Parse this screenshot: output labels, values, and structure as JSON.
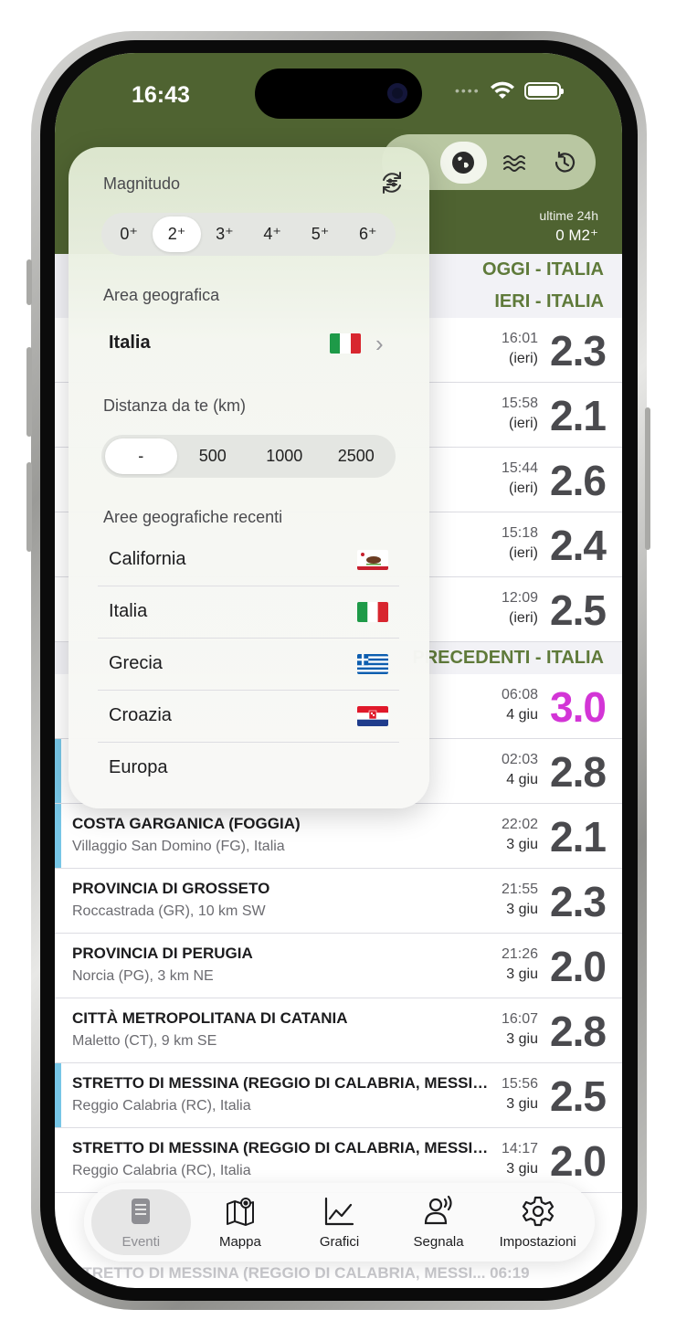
{
  "status": {
    "time": "16:43"
  },
  "header": {
    "segments": [
      {
        "icon": "globe-icon",
        "active": true
      },
      {
        "icon": "waves-icon",
        "active": false
      },
      {
        "icon": "history-icon",
        "active": false
      }
    ],
    "period_label": "ultime 24h",
    "filter_label": "0 M2⁺"
  },
  "sections": [
    {
      "title": "OGGI - ITALIA"
    },
    {
      "title": "IERI - ITALIA"
    },
    {
      "title": "PRECEDENTI - ITALIA"
    }
  ],
  "events_yesterday": [
    {
      "time": "16:01",
      "date": "(ieri)",
      "mag": "2.3",
      "mag_color": "#4a4a4e"
    },
    {
      "time": "15:58",
      "date": "(ieri)",
      "mag": "2.1",
      "mag_color": "#4a4a4e"
    },
    {
      "time": "15:44",
      "date": "(ieri)",
      "mag": "2.6",
      "mag_color": "#4a4a4e"
    },
    {
      "time": "15:18",
      "date": "(ieri)",
      "mag": "2.4",
      "mag_color": "#4a4a4e"
    },
    {
      "time": "12:09",
      "date": "(ieri)",
      "mag": "2.5",
      "mag_color": "#4a4a4e"
    }
  ],
  "events_previous": [
    {
      "title": "",
      "subtitle": "",
      "time": "06:08",
      "date": "4 giu",
      "mag": "3.0",
      "mag_color": "#d335d6",
      "accent": false
    },
    {
      "title": "",
      "subtitle": "",
      "time": "02:03",
      "date": "4 giu",
      "mag": "2.8",
      "mag_color": "#4a4a4e",
      "accent": true
    },
    {
      "title": "COSTA GARGANICA (FOGGIA)",
      "subtitle": "Villaggio San Domino (FG), Italia",
      "time": "22:02",
      "date": "3 giu",
      "mag": "2.1",
      "mag_color": "#4a4a4e",
      "accent": true
    },
    {
      "title": "PROVINCIA DI GROSSETO",
      "subtitle": "Roccastrada (GR), 10 km SW",
      "time": "21:55",
      "date": "3 giu",
      "mag": "2.3",
      "mag_color": "#4a4a4e",
      "accent": false
    },
    {
      "title": "PROVINCIA DI PERUGIA",
      "subtitle": "Norcia (PG), 3 km NE",
      "time": "21:26",
      "date": "3 giu",
      "mag": "2.0",
      "mag_color": "#4a4a4e",
      "accent": false
    },
    {
      "title": "CITTÀ METROPOLITANA DI CATANIA",
      "subtitle": "Maletto (CT), 9 km SE",
      "time": "16:07",
      "date": "3 giu",
      "mag": "2.8",
      "mag_color": "#4a4a4e",
      "accent": false
    },
    {
      "title": "STRETTO DI MESSINA (REGGIO DI CALABRIA, MESSINA)",
      "subtitle": "Reggio Calabria (RC), Italia",
      "time": "15:56",
      "date": "3 giu",
      "mag": "2.5",
      "mag_color": "#4a4a4e",
      "accent": true
    },
    {
      "title": "STRETTO DI MESSINA (REGGIO DI CALABRIA, MESSINA)",
      "subtitle": "Reggio Calabria (RC), Italia",
      "time": "14:17",
      "date": "3 giu",
      "mag": "2.0",
      "mag_color": "#4a4a4e",
      "accent": false
    }
  ],
  "bottom_ghost_text": "STRETTO DI MESSINA (REGGIO DI CALABRIA, MESSI...  06:19",
  "popup": {
    "magnitude_label": "Magnitudo",
    "magnitudes": [
      "0⁺",
      "2⁺",
      "3⁺",
      "4⁺",
      "5⁺",
      "6⁺"
    ],
    "magnitude_selected": 1,
    "area_label": "Area geografica",
    "area_selected": "Italia",
    "distance_label": "Distanza da te (km)",
    "distances": [
      "-",
      "500",
      "1000",
      "2500"
    ],
    "distance_selected": 0,
    "recent_label": "Aree geografiche recenti",
    "recent": [
      {
        "name": "California",
        "flag": "california-flag-icon"
      },
      {
        "name": "Italia",
        "flag": "italy-flag-icon"
      },
      {
        "name": "Grecia",
        "flag": "greece-flag-icon"
      },
      {
        "name": "Croazia",
        "flag": "croatia-flag-icon"
      },
      {
        "name": "Europa",
        "flag": ""
      }
    ]
  },
  "tabs": [
    {
      "label": "Eventi",
      "icon": "events-icon",
      "active": true
    },
    {
      "label": "Mappa",
      "icon": "map-icon",
      "active": false
    },
    {
      "label": "Grafici",
      "icon": "chart-icon",
      "active": false
    },
    {
      "label": "Segnala",
      "icon": "report-icon",
      "active": false
    },
    {
      "label": "Impostazioni",
      "icon": "settings-icon",
      "active": false
    }
  ]
}
